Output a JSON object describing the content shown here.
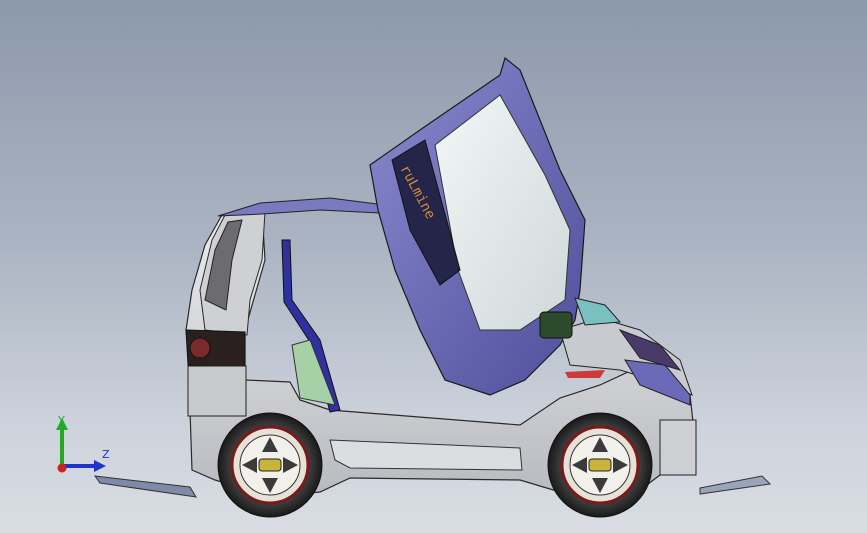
{
  "viewport": {
    "background_top": "#8c99ac",
    "background_bottom": "#d9dde3"
  },
  "model": {
    "door_logo_text": "ruLmine",
    "body_color": "#d8d8dc",
    "accent_color": "#6a6ab8",
    "glass_color": "#e8f0f0"
  },
  "triad": {
    "y_label": "Y",
    "z_label": "Z",
    "y_color": "#22aa22",
    "z_color": "#2233cc",
    "x_color": "#cc2222"
  }
}
